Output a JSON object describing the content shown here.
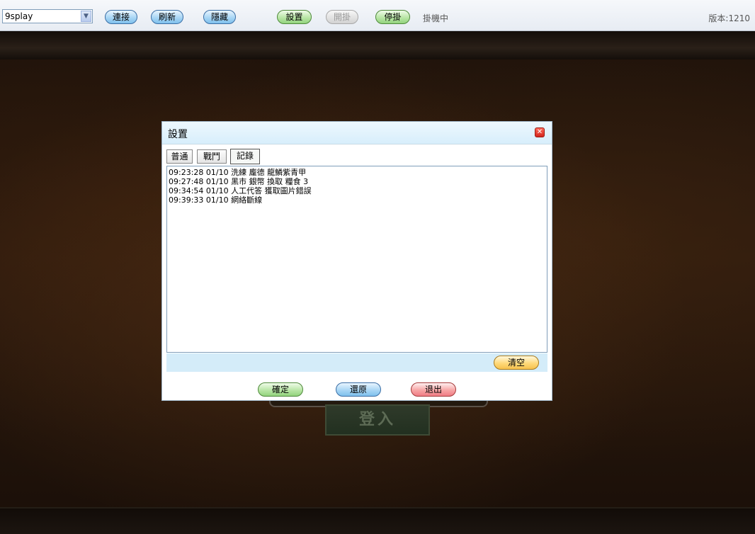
{
  "toolbar": {
    "server_select_value": "9splay",
    "connect_label": "連接",
    "refresh_label": "刷新",
    "hide_label": "隱藏",
    "settings_label": "設置",
    "start_label": "開掛",
    "stop_label": "停掛",
    "status_text": "掛機中",
    "version_text": "版本:1210"
  },
  "game": {
    "login_label": "登入"
  },
  "dialog": {
    "title": "設置",
    "tabs": [
      {
        "label": "普通"
      },
      {
        "label": "戰鬥"
      },
      {
        "label": "記錄"
      }
    ],
    "active_tab": "記錄",
    "log_lines": [
      "09:23:28 01/10  洗練   龐德  龍鱗紫青甲",
      "09:27:48 01/10  黑市   銀幣 換取 糧食  3",
      "09:34:54 01/10  人工代答    獲取圖片錯誤",
      "09:39:33 01/10  網絡斷線"
    ],
    "clear_label": "清空",
    "ok_label": "確定",
    "restore_label": "還原",
    "exit_label": "退出"
  }
}
